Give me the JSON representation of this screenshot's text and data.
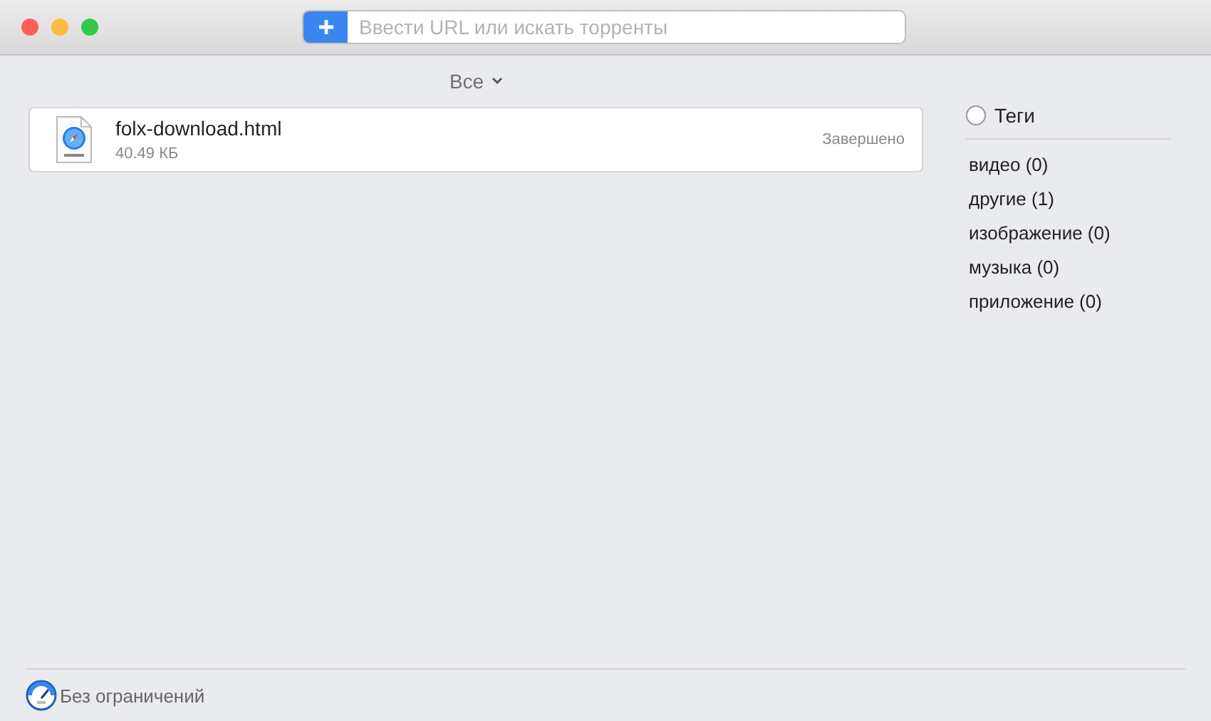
{
  "toolbar": {
    "search": {
      "placeholder": "Ввести URL или искать торренты"
    }
  },
  "filter": {
    "label": "Все"
  },
  "downloads": [
    {
      "name": "folx-download.html",
      "size": "40.49  КБ",
      "status": "Завершено"
    }
  ],
  "tags": {
    "title": "Теги",
    "on": false,
    "items": [
      {
        "label": "видео (0)"
      },
      {
        "label": "другие (1)"
      },
      {
        "label": "изображение (0)"
      },
      {
        "label": "музыка (0)"
      },
      {
        "label": "приложение (0)"
      }
    ]
  },
  "footer": {
    "speed_limit": "Без ограничений"
  }
}
